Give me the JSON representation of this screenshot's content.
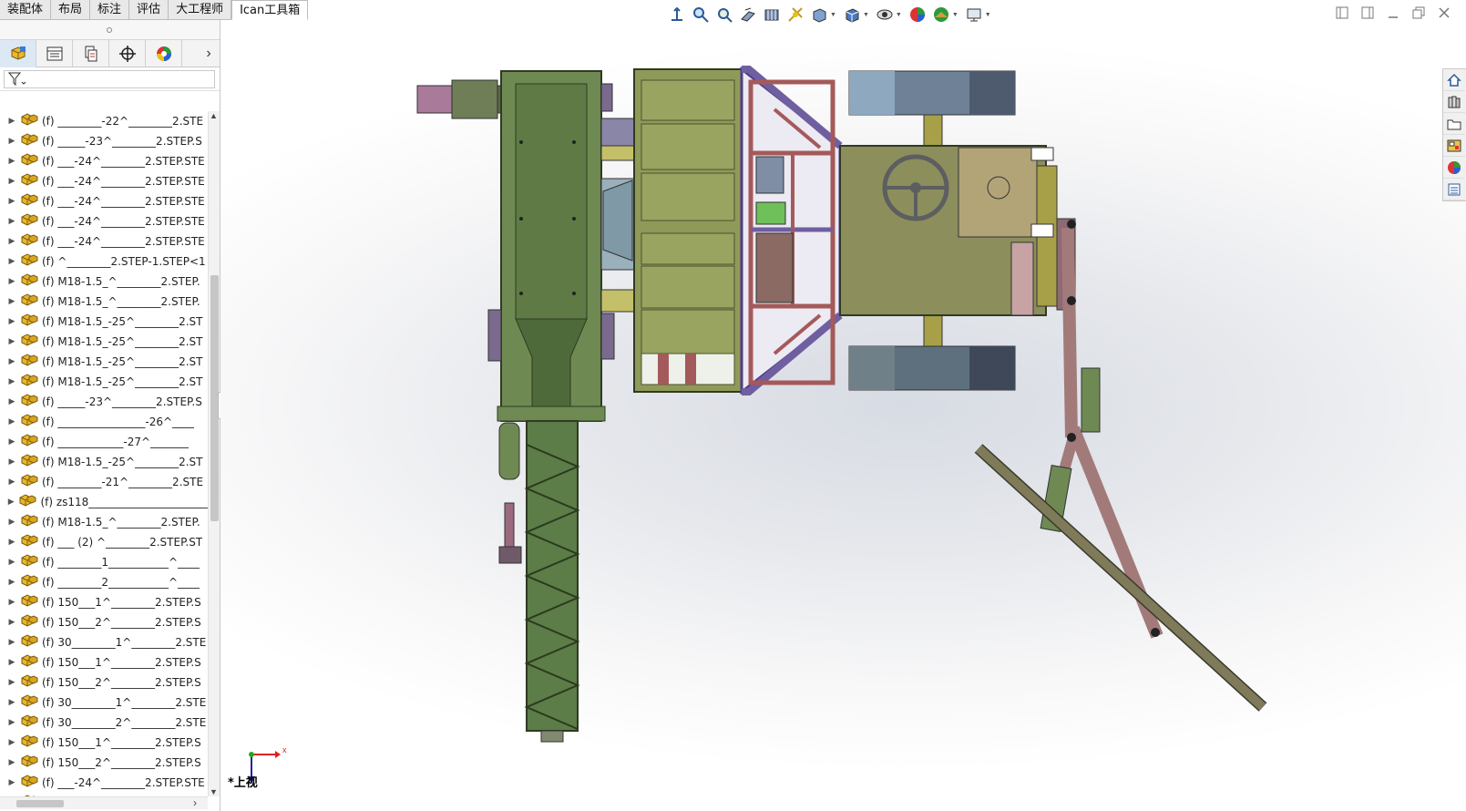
{
  "tabs": [
    "装配体",
    "布局",
    "标注",
    "评估",
    "大工程师",
    "Ican工具箱"
  ],
  "active_tab_index": 5,
  "panel_tabs": [
    "feature-manager",
    "property-manager",
    "configuration-manager",
    "dimxpert-manager",
    "display-manager"
  ],
  "tree_items": [
    "(f) ________-22^________2.STE",
    "(f) _____-23^________2.STEP.S",
    "(f) ___-24^________2.STEP.STE",
    "(f) ___-24^________2.STEP.STE",
    "(f) ___-24^________2.STEP.STE",
    "(f) ___-24^________2.STEP.STE",
    "(f) ___-24^________2.STEP.STE",
    "(f) ^________2.STEP-1.STEP<1",
    "(f) M18-1.5_^________2.STEP.",
    "(f) M18-1.5_^________2.STEP.",
    "(f) M18-1.5_-25^________2.ST",
    "(f) M18-1.5_-25^________2.ST",
    "(f) M18-1.5_-25^________2.ST",
    "(f) M18-1.5_-25^________2.ST",
    "(f) _____-23^________2.STEP.S",
    "(f) ________________-26^____",
    "(f) ____________-27^_______",
    "(f) M18-1.5_-25^________2.ST",
    "(f) ________-21^________2.STE",
    "(f) zs118_______________________^",
    "(f) M18-1.5_^________2.STEP.",
    "(f) ___ (2) ^________2.STEP.ST",
    "(f) ________1___________^____",
    "(f) ________2___________^____",
    "(f) 150___1^________2.STEP.S",
    "(f) 150___2^________2.STEP.S",
    "(f) 30________1^________2.STE",
    "(f) 150___1^________2.STEP.S",
    "(f) 150___2^________2.STEP.S",
    "(f) 30________1^________2.STE",
    "(f) 30________2^________2.STE",
    "(f) 150___1^________2.STEP.S",
    "(f) 150___2^________2.STEP.S",
    "(f) ___-24^________2.STEP.STE",
    "(f) __________-28^________2.ST"
  ],
  "view_label": "*上视",
  "triad": {
    "x_label": "x",
    "y_label": "y"
  },
  "heads_up_icons": [
    "zoom-to-fit-icon",
    "zoom-area-icon",
    "previous-view-icon",
    "section-view-icon",
    "dynamic-annotation-icon",
    "view-orientation-icon",
    "display-style-icon",
    "hide-show-icon",
    "edit-appearance-icon",
    "apply-scene-icon",
    "view-settings-icon",
    "display-icon"
  ],
  "task_pane_icons": [
    "home-icon",
    "design-library-icon",
    "file-explorer-icon",
    "view-palette-icon",
    "appearances-icon",
    "custom-properties-icon"
  ],
  "colors": {
    "frame_green": "#6e8a52",
    "frame_olive": "#8f9a59",
    "purple_brace": "#6f5ea0",
    "red_tube": "#a45a5a",
    "wheel": "#6e8197",
    "tan_box": "#b3a478"
  }
}
